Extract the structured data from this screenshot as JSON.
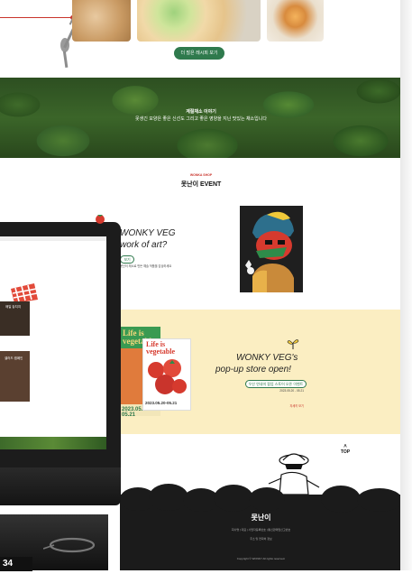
{
  "page": {
    "more_button": "더 많은 레시피 보기",
    "banner_line1": "계절채소 이야기",
    "banner_line2": "못생긴 모양은 좋은 신선도 그리고 좋은 영양을 지닌 맛있는 채소입니다",
    "event_kicker": "WONKA SHOP",
    "event_title": "못난이 EVENT",
    "event1_title_line1": "WONKY VEG",
    "event1_title_line2": "work of art?",
    "event1_pill": "보기",
    "event1_desc": "못난이 채소로 만든 예술 작품을 감상하세요",
    "popup_title_line1": "WONKY VEG's",
    "popup_title_line2": "pop-up store open!",
    "popup_pill": "우산 연내미 팝업 스토어 오픈 이벤트",
    "popup_date_text": "2023.05.20 - 05.21",
    "popup_link": "자세히 보기",
    "poster_title": "Life is vegetable",
    "poster_dates": "2023.05.20-05.21",
    "top_button": "TOP",
    "footer_brand": "못난이",
    "footer_line1": "회사명 | 대표 | 사업자등록번호 | 통신판매업신고번호",
    "footer_line2": "주소 및 연락처 정보",
    "footer_copyright": "Copyright © WONKY All rights reserved.",
    "screen_items": [
      "매일 놓치지",
      "셀러드 캠페인"
    ],
    "page_number": "34"
  },
  "colors": {
    "accent_green": "#2f7a4d",
    "accent_red": "#c9342c",
    "yellow_band": "#fbeec2",
    "footer_bg": "#1b1b1b"
  }
}
